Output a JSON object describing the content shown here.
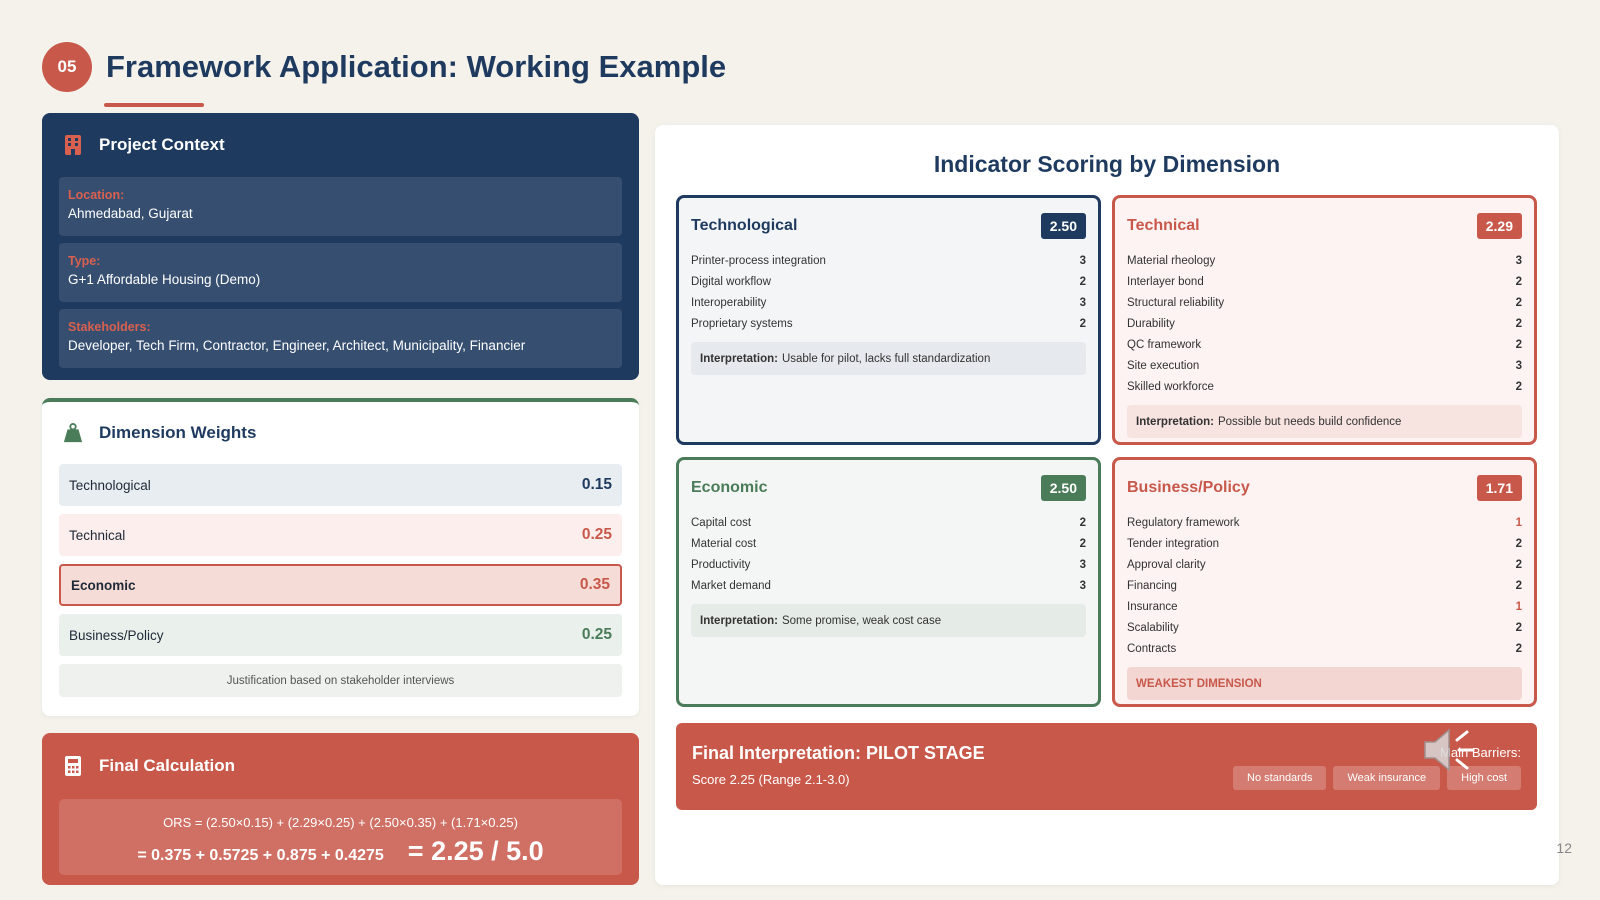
{
  "header": {
    "number": "05",
    "title": "Framework Application: Working Example"
  },
  "context": {
    "title": "Project Context",
    "icon": "building-icon",
    "items": [
      {
        "key": "Location:",
        "value": "Ahmedabad, Gujarat"
      },
      {
        "key": "Type:",
        "value": "G+1 Affordable Housing (Demo)"
      },
      {
        "key": "Stakeholders:",
        "value": "Developer, Tech Firm, Contractor, Engineer, Architect, Municipality, Financier"
      }
    ]
  },
  "weights": {
    "title": "Dimension Weights",
    "icon": "weight-icon",
    "items": [
      {
        "label": "Technological",
        "value": "0.15"
      },
      {
        "label": "Technical",
        "value": "0.25"
      },
      {
        "label": "Economic",
        "value": "0.35"
      },
      {
        "label": "Business/Policy",
        "value": "0.25"
      }
    ],
    "note": "Justification based on stakeholder interviews"
  },
  "calc": {
    "title": "Final Calculation",
    "icon": "calculator-icon",
    "formula": "ORS = (2.50×0.15) + (2.29×0.25) + (2.50×0.35) + (1.71×0.25)",
    "sum": "= 0.375 + 0.5725 + 0.875 + 0.4275",
    "result": "= 2.25 / 5.0"
  },
  "scoring": {
    "title": "Indicator Scoring by Dimension",
    "dimensions": [
      {
        "name": "Technological",
        "score": "2.50",
        "indicators": [
          {
            "label": "Printer-process integration",
            "value": "3"
          },
          {
            "label": "Digital workflow",
            "value": "2"
          },
          {
            "label": "Interoperability",
            "value": "3"
          },
          {
            "label": "Proprietary systems",
            "value": "2"
          }
        ],
        "interp_label": "Interpretation:",
        "interp_text": "Usable for pilot, lacks full standardization"
      },
      {
        "name": "Technical",
        "score": "2.29",
        "indicators": [
          {
            "label": "Material rheology",
            "value": "3"
          },
          {
            "label": "Interlayer bond",
            "value": "2"
          },
          {
            "label": "Structural reliability",
            "value": "2"
          },
          {
            "label": "Durability",
            "value": "2"
          },
          {
            "label": "QC framework",
            "value": "2"
          },
          {
            "label": "Site execution",
            "value": "3"
          },
          {
            "label": "Skilled workforce",
            "value": "2"
          }
        ],
        "interp_label": "Interpretation:",
        "interp_text": "Possible but needs build confidence"
      },
      {
        "name": "Economic",
        "score": "2.50",
        "indicators": [
          {
            "label": "Capital cost",
            "value": "2"
          },
          {
            "label": "Material cost",
            "value": "2"
          },
          {
            "label": "Productivity",
            "value": "3"
          },
          {
            "label": "Market demand",
            "value": "3"
          }
        ],
        "interp_label": "Interpretation:",
        "interp_text": "Some promise, weak cost case"
      },
      {
        "name": "Business/Policy",
        "score": "1.71",
        "indicators": [
          {
            "label": "Regulatory framework",
            "value": "1"
          },
          {
            "label": "Tender integration",
            "value": "2"
          },
          {
            "label": "Approval clarity",
            "value": "2"
          },
          {
            "label": "Financing",
            "value": "2"
          },
          {
            "label": "Insurance",
            "value": "1"
          },
          {
            "label": "Scalability",
            "value": "2"
          },
          {
            "label": "Contracts",
            "value": "2"
          }
        ],
        "interp_text": "WEAKEST DIMENSION"
      }
    ]
  },
  "final": {
    "title": "Final Interpretation: PILOT STAGE",
    "score": "Score 2.25 (Range 2.1-3.0)",
    "barriers_label": "Main Barriers:",
    "barriers": [
      "No standards",
      "Weak insurance",
      "High cost"
    ]
  },
  "page_number": "12",
  "colors": {
    "navy": "#1e3a5f",
    "coral": "#c8584a",
    "green": "#4a7c59",
    "background": "#f5f2ec"
  }
}
